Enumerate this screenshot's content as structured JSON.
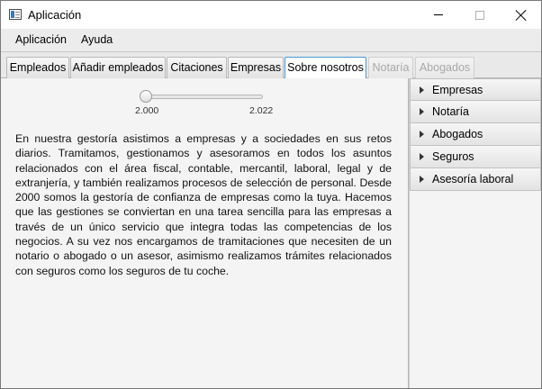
{
  "window": {
    "title": "Aplicación"
  },
  "menu": {
    "items": [
      "Aplicación",
      "Ayuda"
    ]
  },
  "tabs": [
    {
      "label": "Empleados",
      "state": "normal"
    },
    {
      "label": "Añadir empleados",
      "state": "normal"
    },
    {
      "label": "Citaciones",
      "state": "normal"
    },
    {
      "label": "Empresas",
      "state": "normal"
    },
    {
      "label": "Sobre nosotros",
      "state": "selected"
    },
    {
      "label": "Notaría",
      "state": "disabled"
    },
    {
      "label": "Abogados",
      "state": "disabled"
    }
  ],
  "slider": {
    "min_label": "2.000",
    "max_label": "2.022",
    "value": 2000
  },
  "about": {
    "text": "En nuestra gestoría  asistimos a empresas y a sociedades en sus retos diarios. Tramitamos, gestionamos y asesoramos en todos los asuntos relacionados con el área fiscal, contable, mercantil, laboral, legal y de extranjería, y también realizamos procesos de selección de personal. Desde 2000 somos la gestoría de confianza de empresas como la tuya. Hacemos que las gestiones se conviertan en una tarea sencilla para las empresas a través de un único servicio que integra todas las competencias de los negocios. A su vez nos encargamos de tramitaciones que necesiten de un notario o abogado o un asesor, asimismo realizamos trámites relacionados con seguros como los seguros de tu coche."
  },
  "accordion": {
    "items": [
      "Empresas",
      "Notaría",
      "Abogados",
      "Seguros",
      "Asesoría laboral"
    ]
  },
  "colors": {
    "selected_tab_border": "#4b9ad6",
    "disabled_text": "#a9a9a9",
    "window_bg": "#f4f4f4"
  }
}
